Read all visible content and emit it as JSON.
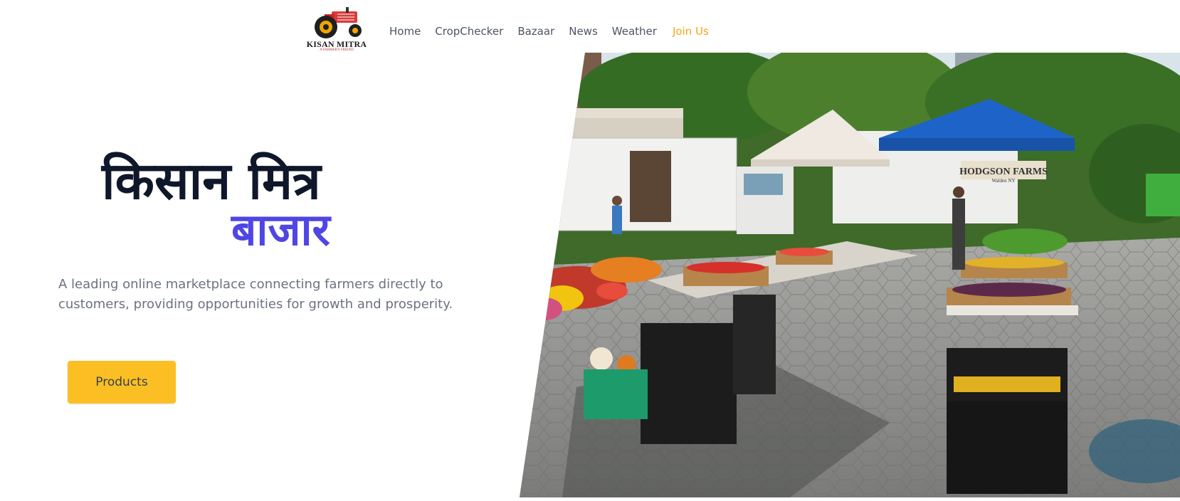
{
  "brand": {
    "name": "KISAN MITRA",
    "tagline": "A FARMER'S FRIEND"
  },
  "nav": {
    "items": [
      "Home",
      "CropChecker",
      "Bazaar",
      "News",
      "Weather"
    ],
    "join_label": "Join Us"
  },
  "hero": {
    "title_line1": "किसान मित्र",
    "title_line2": "बाजार",
    "description": "A leading online marketplace connecting farmers directly to customers, providing opportunities for growth and prosperity.",
    "cta_label": "Products"
  },
  "photo": {
    "stall_sign": "HODGSON FARMS",
    "stall_sign_sub": "Walden NY"
  },
  "colors": {
    "accent": "#4f46e5",
    "button": "#fbbf24",
    "join": "#f3a712",
    "heading": "#0f172a"
  }
}
